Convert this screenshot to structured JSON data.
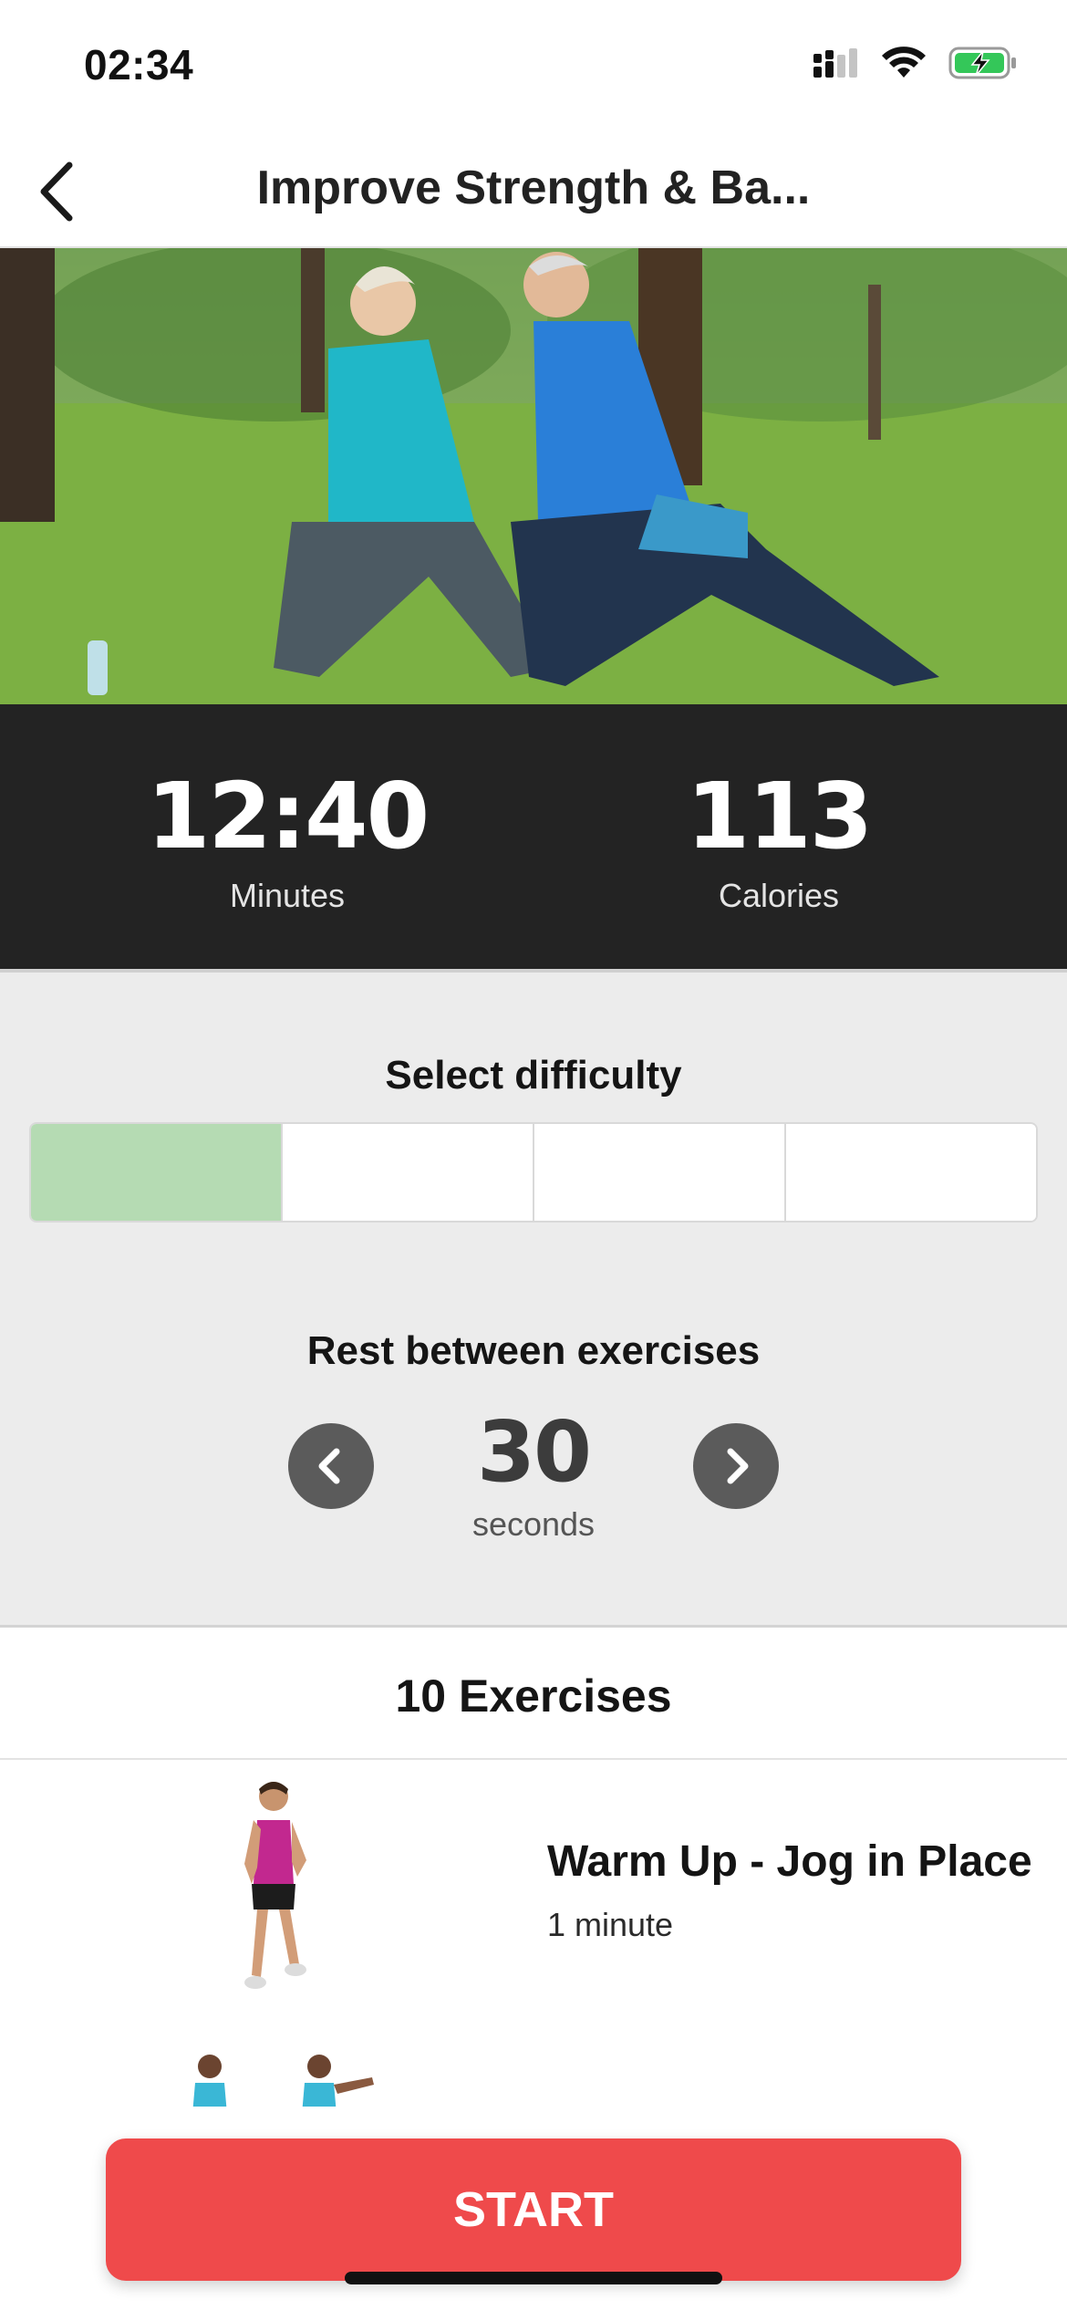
{
  "status_bar": {
    "time": "02:34",
    "icons": [
      "cellular-signal-icon",
      "wifi-icon",
      "battery-charging-icon"
    ]
  },
  "nav": {
    "title": "Improve Strength & Ba...",
    "back_icon": "chevron-left-icon"
  },
  "hero": {
    "image": "photo of two seniors doing lunge stretches in a park"
  },
  "stats": {
    "duration_value": "12:40",
    "duration_label": "Minutes",
    "calories_value": "113",
    "calories_label": "Calories"
  },
  "settings": {
    "difficulty_title": "Select difficulty",
    "difficulty_selected_level": 1,
    "difficulty_levels_total": 4,
    "rest_title": "Rest between exercises",
    "rest_value": "30",
    "rest_unit": "seconds"
  },
  "exercises": {
    "header": "10 Exercises",
    "items": [
      {
        "name": "Warm Up - Jog in Place",
        "duration": "1 minute"
      },
      {
        "name": "",
        "duration": ""
      }
    ]
  },
  "actions": {
    "start_label": "START"
  },
  "colors": {
    "accent_red": "#ef4a4b",
    "stats_bg": "#232323",
    "settings_bg": "#ececec",
    "difficulty_active": "#b5dbb3",
    "control_gray": "#5b5b5b"
  }
}
